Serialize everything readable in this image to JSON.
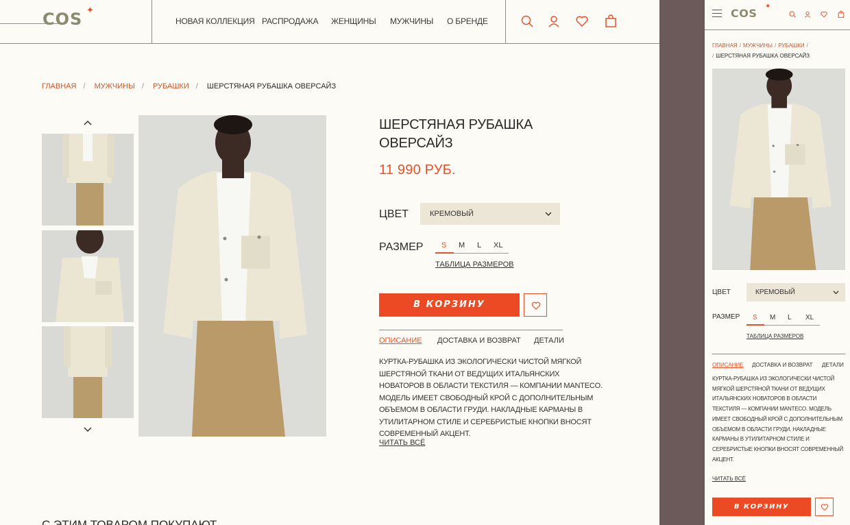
{
  "brand": {
    "logo": "COS",
    "accent": "#ec4a24",
    "background": "#fcfbf5",
    "select_bg": "#ece6d6"
  },
  "nav": {
    "items": [
      "НОВАЯ КОЛЛЕКЦИЯ",
      "РАСПРОДАЖА",
      "ЖЕНЩИНЫ",
      "МУЖЧИНЫ",
      "О БРЕНДЕ"
    ],
    "icons": [
      "search-icon",
      "user-icon",
      "heart-icon",
      "bag-icon"
    ]
  },
  "breadcrumbs": [
    "ГЛАВНАЯ",
    "МУЖЧИНЫ",
    "РУБАШКИ",
    "ШЕРСТЯНАЯ РУБАШКА ОВЕРСАЙЗ"
  ],
  "product": {
    "title": "ШЕРСТЯНАЯ РУБАШКА ОВЕРСАЙЗ",
    "price": "11 990 РУБ.",
    "color_label": "ЦВЕТ",
    "color_value": "КРЕМОВЫЙ",
    "size_label": "РАЗМЕР",
    "sizes": [
      "S",
      "M",
      "L",
      "XL"
    ],
    "selected_size": "S",
    "size_table": "ТАБЛИЦА РАЗМЕРОВ",
    "cart_button": "В КОРЗИНУ",
    "tabs": [
      "ОПИСАНИЕ",
      "ДОСТАВКА И ВОЗВРАТ",
      "ДЕТАЛИ"
    ],
    "active_tab": "ОПИСАНИЕ",
    "description": "КУРТКА-РУБАШКА ИЗ ЭКОЛОГИЧЕСКИ ЧИСТОЙ МЯГКОЙ ШЕРСТЯНОЙ ТКАНИ ОТ ВЕДУЩИХ ИТАЛЬЯНСКИХ НОВАТОРОВ В ОБЛАСТИ ТЕКСТИЛЯ — КОМПАНИИ MANTECO. МОДЕЛЬ ИМЕЕТ СВОБОДНЫЙ КРОЙ С ДОПОЛНИТЕЛЬНЫМ ОБЪЕМОМ В ОБЛАСТИ ГРУДИ. НАКЛАДНЫЕ КАРМАНЫ В УТИЛИТАРНОМ СТИЛЕ И СЕРЕБРИСТЫЕ КНОПКИ ВНОСЯТ СОВРЕМЕННЫЙ АКЦЕНТ.",
    "read_all": "ЧИТАТЬ ВСЁ"
  },
  "related_title": "С ЭТИМ ТОВАРОМ ПОКУПАЮТ"
}
